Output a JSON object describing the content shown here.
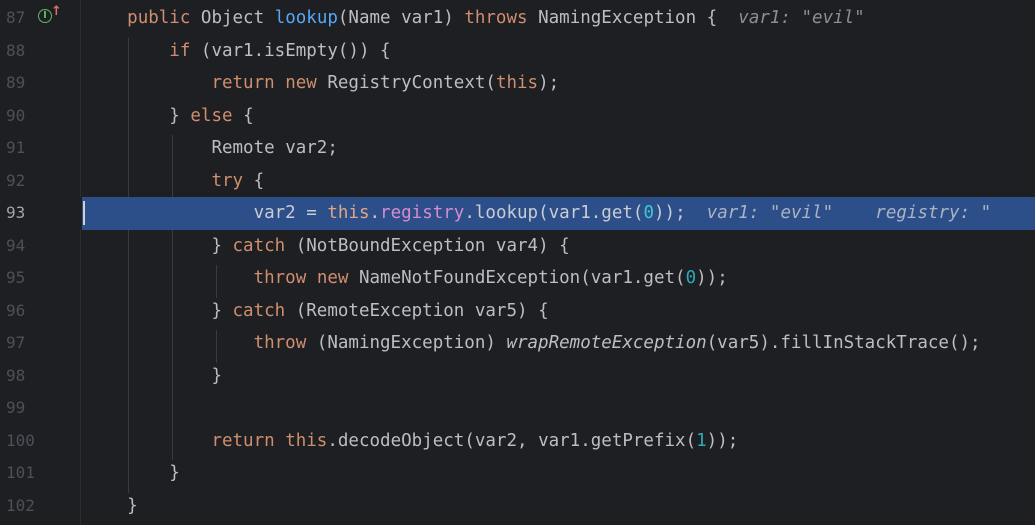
{
  "gutter": {
    "line_numbers": [
      "87",
      "88",
      "89",
      "90",
      "91",
      "92",
      "93",
      "94",
      "95",
      "96",
      "97",
      "98",
      "99",
      "100",
      "101",
      "102"
    ],
    "current_line": "93",
    "icons": [
      "implements-method-icon",
      "overriding-up-arrow-icon"
    ]
  },
  "code": {
    "l87": {
      "kw1": "public",
      "t1": " Object ",
      "fn": "lookup",
      "t2": "(Name var1) ",
      "kw2": "throws",
      "t3": " NamingException {",
      "hint": "var1: \"evil\""
    },
    "l88": {
      "kw1": "if",
      "t1": " (var1.isEmpty()) {"
    },
    "l89": {
      "kw1": "return",
      "t1": " ",
      "kw2": "new",
      "t2": " RegistryContext(",
      "kw3": "this",
      "t3": ");"
    },
    "l90": {
      "t1": "} ",
      "kw1": "else",
      "t2": " {"
    },
    "l91": {
      "t1": "Remote var2;"
    },
    "l92": {
      "kw1": "try",
      "t1": " {"
    },
    "l93": {
      "t1": "var2 = ",
      "kw1": "this",
      "t2": ".",
      "fld": "registry",
      "t3": ".lookup(var1.get(",
      "num": "0",
      "t4": "));",
      "hint1": "var1: \"evil\"",
      "hint2": "registry: \""
    },
    "l94": {
      "t1": "} ",
      "kw1": "catch",
      "t2": " (NotBoundException var4) {"
    },
    "l95": {
      "kw1": "throw",
      "t1": " ",
      "kw2": "new",
      "t2": " NameNotFoundException(var1.get(",
      "num": "0",
      "t3": "));"
    },
    "l96": {
      "t1": "} ",
      "kw1": "catch",
      "t2": " (RemoteException var5) {"
    },
    "l97": {
      "kw1": "throw",
      "t1": " (NamingException) ",
      "it": "wrapRemoteException",
      "t2": "(var5).fillInStackTrace();"
    },
    "l98": {
      "t1": "}"
    },
    "l99": {},
    "l100": {
      "kw1": "return",
      "t1": " ",
      "kw2": "this",
      "t2": ".decodeObject(var2, var1.getPrefix(",
      "num": "1",
      "t3": "));"
    },
    "l101": {
      "t1": "}"
    },
    "l102": {
      "t1": "}"
    }
  },
  "colors": {
    "background": "#1e1f22",
    "execution_line": "#2d4f89",
    "keyword": "#cf8e6d",
    "method": "#56a8f5",
    "field": "#c77dbb",
    "number": "#2aacb8",
    "inlay_hint": "#8c8f96",
    "text": "#bcbec4"
  }
}
